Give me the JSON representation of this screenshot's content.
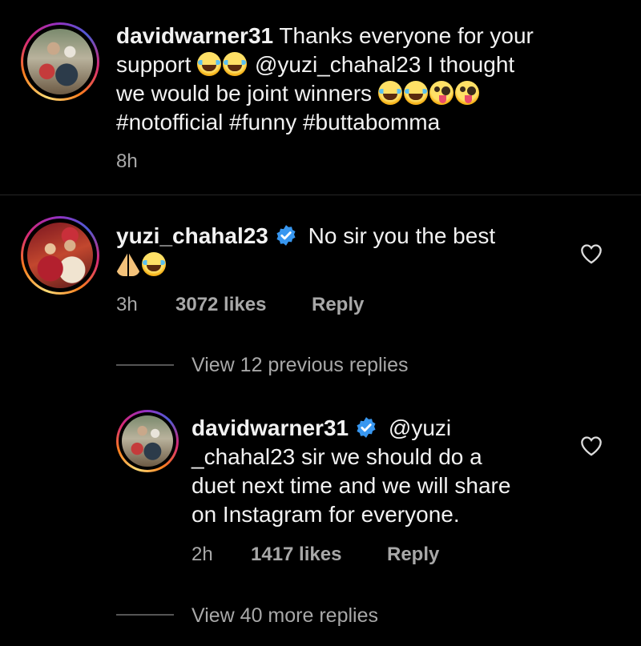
{
  "comments": [
    {
      "username": "davidwarner31",
      "text_line1": "Thanks everyone for your",
      "text_line2_a": "support",
      "text_line2_b": "@yuzi_chahal23 I thought",
      "text_line3": "we would be joint winners",
      "text_line4": "#notofficial #funny #buttabomma",
      "time": "8h"
    },
    {
      "username": "yuzi_chahal23",
      "text_line1": "No sir you the best",
      "time": "3h",
      "likes": "3072 likes",
      "reply": "Reply"
    }
  ],
  "view_previous": "View 12 previous replies",
  "reply_comment": {
    "username": "davidwarner31",
    "text_line1": "@yuzi",
    "text_line2": "_chahal23 sir we should do a",
    "text_line3": "duet next time and we will share",
    "text_line4": "on Instagram for everyone.",
    "time": "2h",
    "likes": "1417 likes",
    "reply": "Reply"
  },
  "view_more": "View 40 more replies",
  "colors": {
    "background": "#000000",
    "text": "#f2f2f2",
    "secondary": "#a8a8a8",
    "verified": "#3897f0"
  }
}
